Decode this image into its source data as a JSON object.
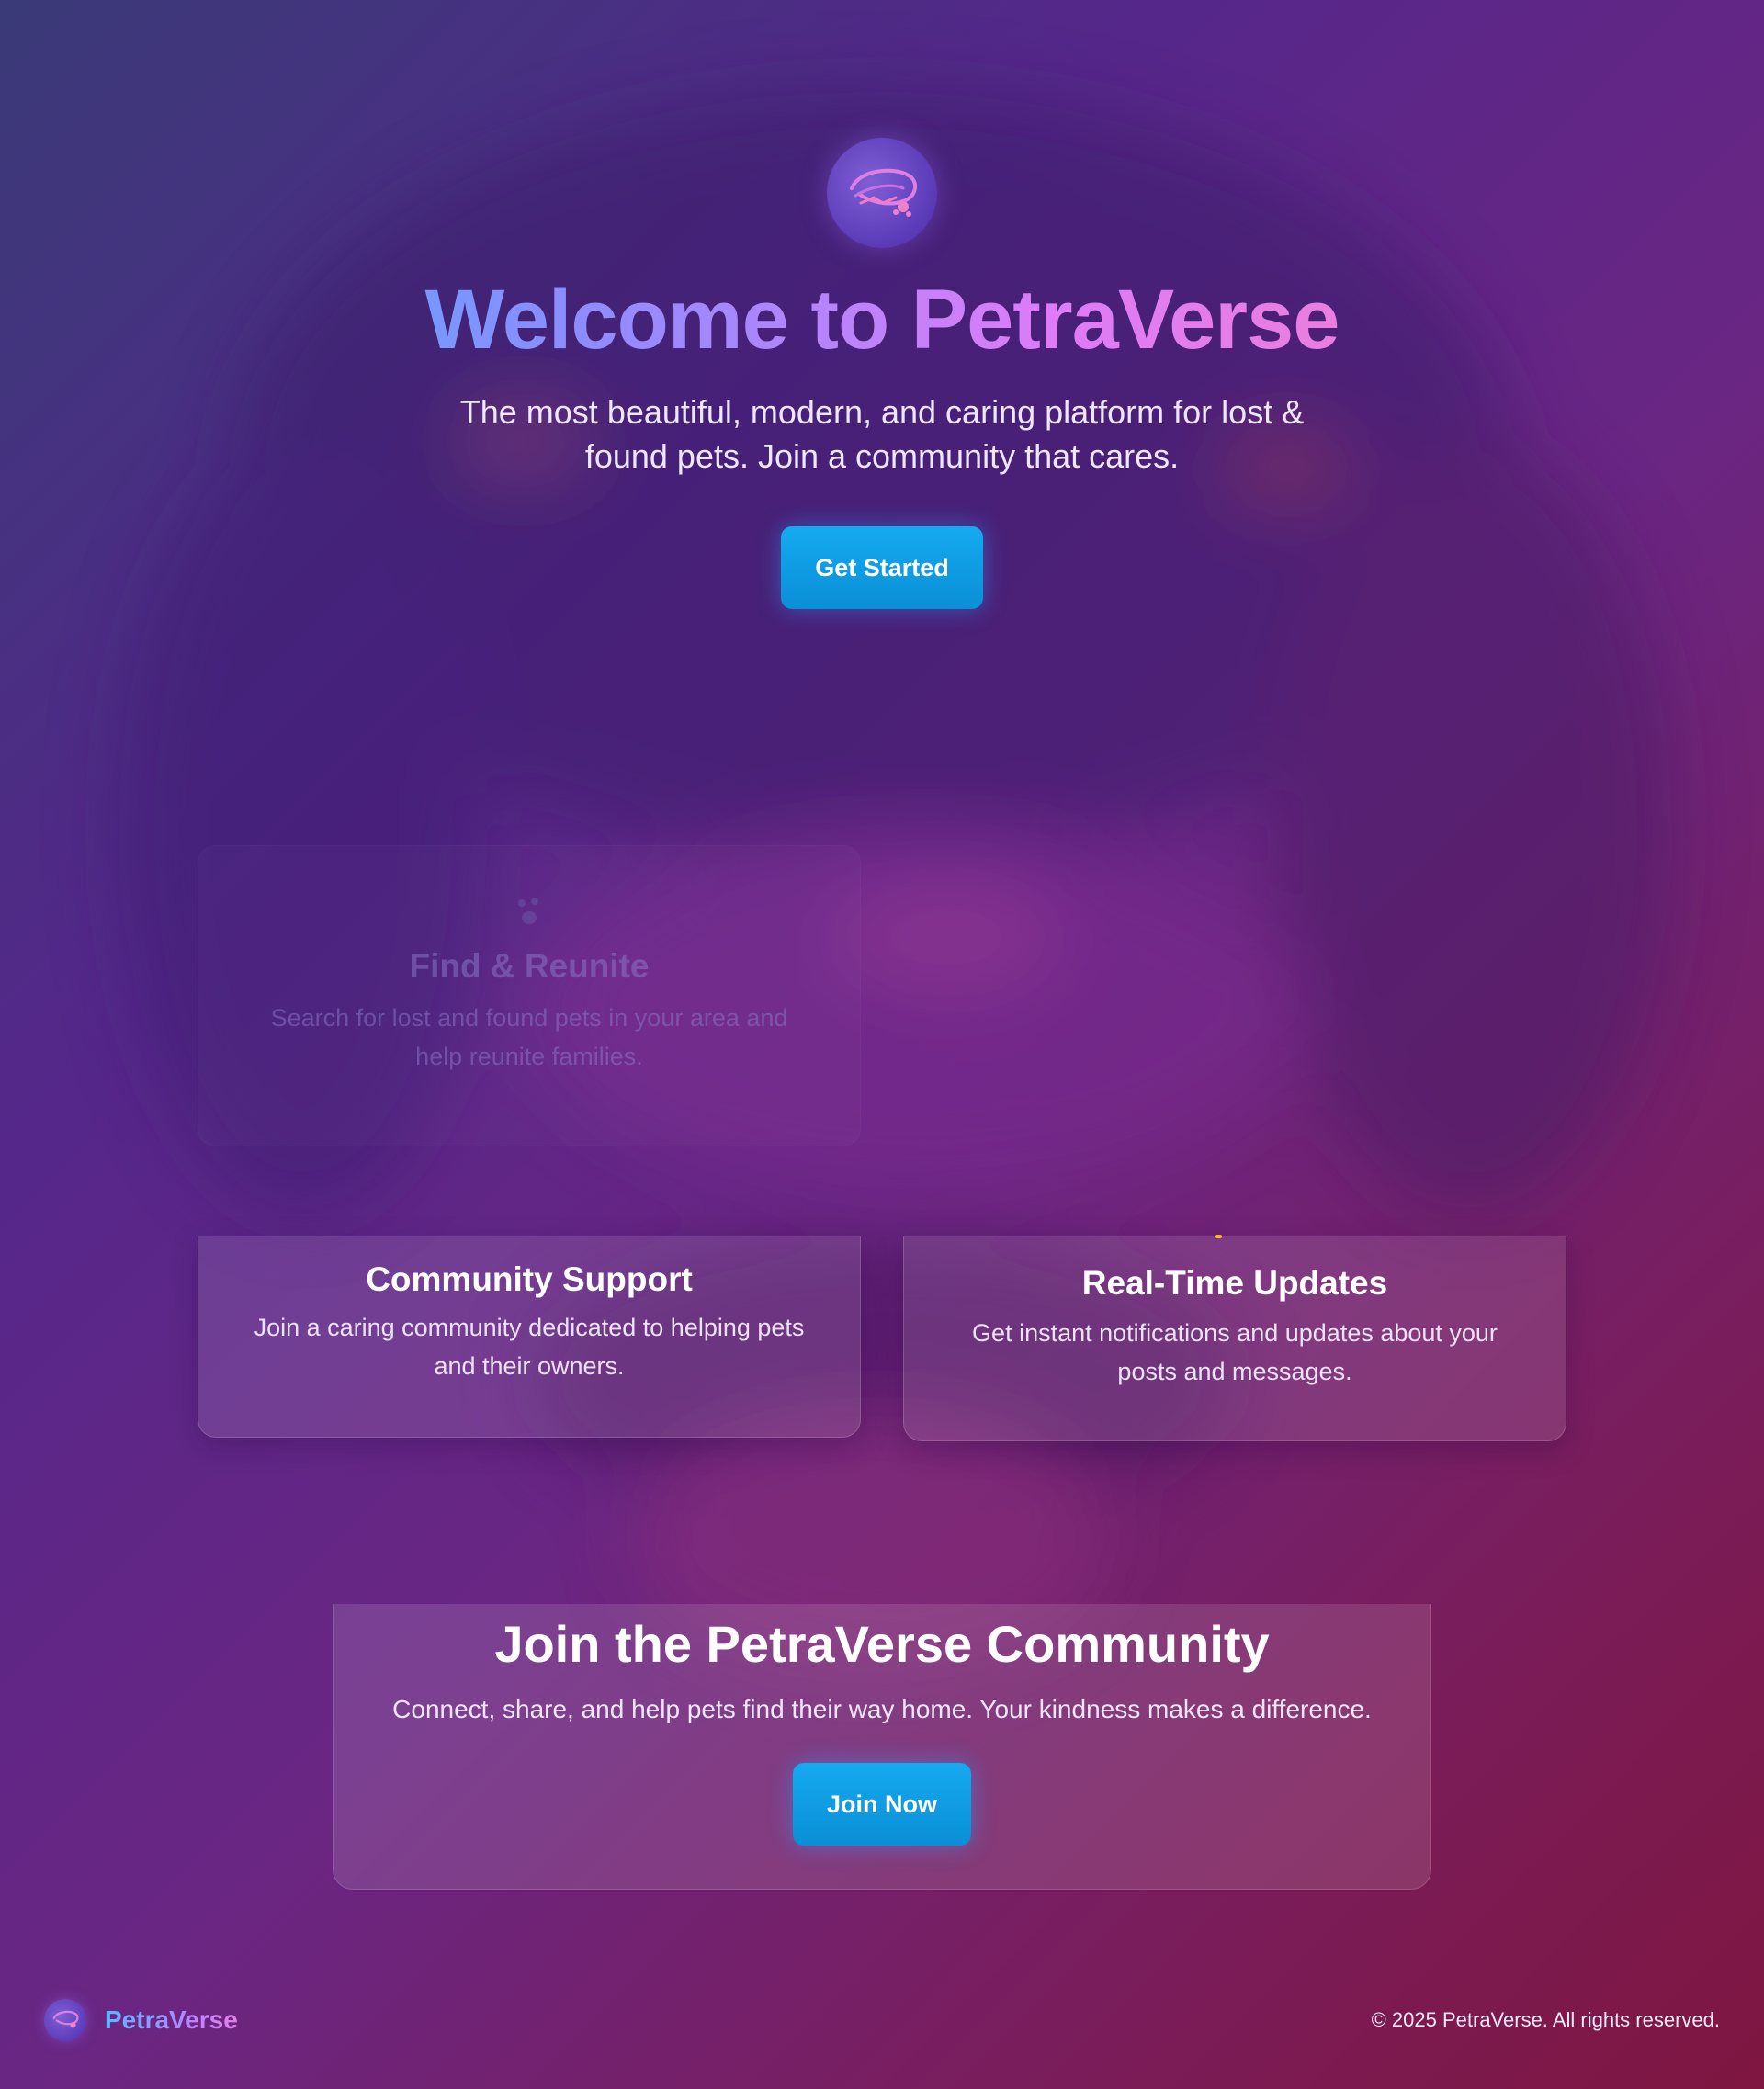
{
  "hero": {
    "logo_icon": "petraverse-logo-icon",
    "title": "Welcome to PetraVerse",
    "subtitle": "The most beautiful, modern, and caring platform for lost & found pets. Join a community that cares.",
    "cta_label": "Get Started"
  },
  "features": {
    "find": {
      "icon": "paw-icon",
      "title": "Find & Reunite",
      "description": "Search for lost and found pets in your area and help reunite families."
    },
    "community": {
      "title": "Community Support",
      "description": "Join a caring community dedicated to helping pets and their owners."
    },
    "updates": {
      "title": "Real-Time Updates",
      "description": "Get instant notifications and updates about your posts and messages."
    }
  },
  "cta_section": {
    "title": "Join the PetraVerse Community",
    "description": "Connect, share, and help pets find their way home. Your kindness makes a difference.",
    "button_label": "Join Now"
  },
  "footer": {
    "brand": "PetraVerse",
    "copyright": "© 2025 PetraVerse. All rights reserved."
  },
  "colors": {
    "accent_blue": "#15aaf0",
    "gradient_start": "#3fb6ff",
    "gradient_end": "#f56fb1",
    "background_top": "#3a3a78",
    "background_bottom": "#7e1640"
  }
}
